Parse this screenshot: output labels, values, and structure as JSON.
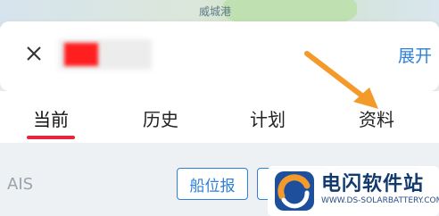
{
  "map": {
    "place_label": "威城港"
  },
  "header": {
    "close_icon": "close-icon",
    "vessel_name": "",
    "expand_label": "展开"
  },
  "tabs": [
    {
      "label": "当前",
      "active": true
    },
    {
      "label": "历史",
      "active": false
    },
    {
      "label": "计划",
      "active": false
    },
    {
      "label": "资料",
      "active": false
    }
  ],
  "ais": {
    "label": "AIS",
    "buttons": [
      {
        "label": "船位报"
      },
      {
        "label": ""
      },
      {
        "label": ""
      }
    ]
  },
  "watermark": {
    "title": "电闪软件站",
    "url": "WWW.DS-SOLARBATTERY.COM"
  },
  "colors": {
    "accent": "#2f80d8",
    "tab_indicator": "#e8253a",
    "annotation_arrow": "#f39a2b"
  }
}
